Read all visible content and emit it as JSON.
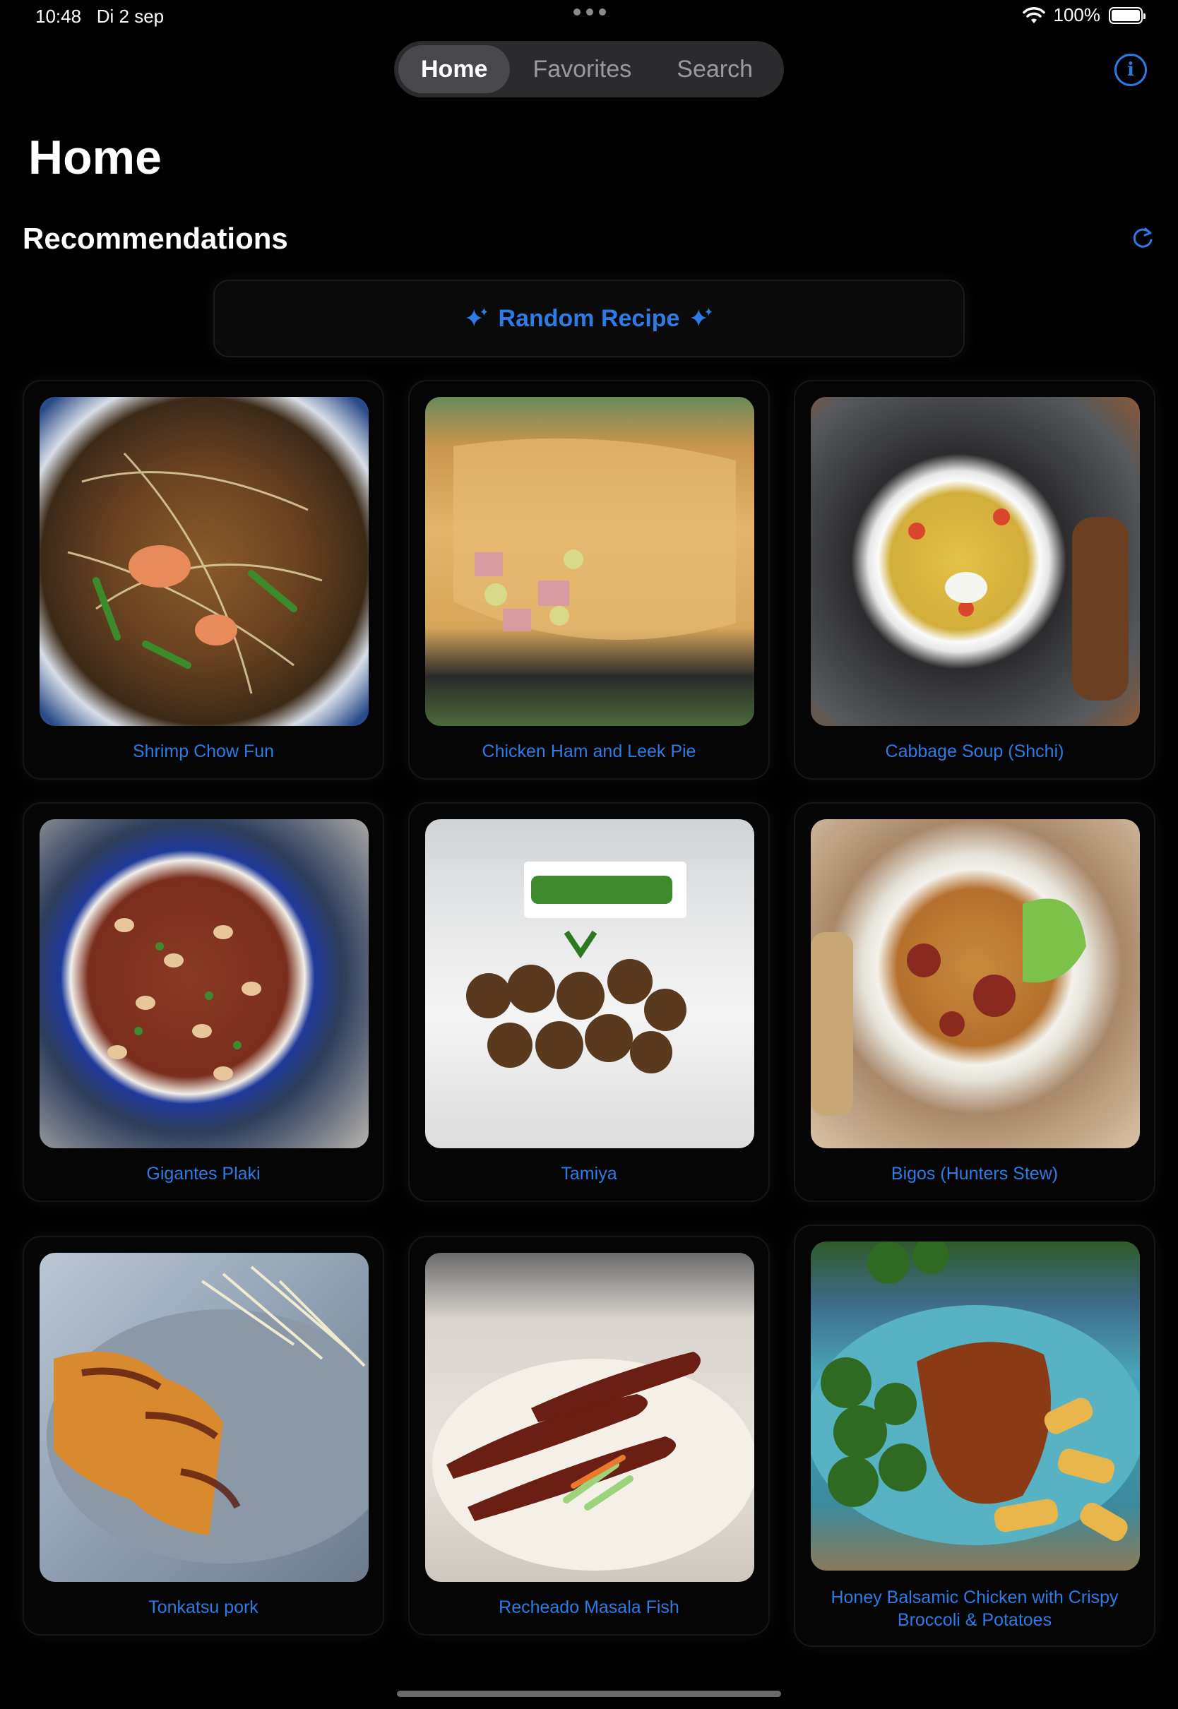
{
  "status_bar": {
    "time": "10:48",
    "date": "Di 2 sep",
    "battery": "100%"
  },
  "tabs": [
    {
      "label": "Home",
      "active": true
    },
    {
      "label": "Favorites",
      "active": false
    },
    {
      "label": "Search",
      "active": false
    }
  ],
  "page_title": "Home",
  "section_title": "Recommendations",
  "random_button": {
    "label": "Random Recipe"
  },
  "colors": {
    "accent": "#2d7be5",
    "background": "#000000",
    "card": "#050505"
  },
  "recipes": [
    {
      "name": "Shrimp Chow Fun"
    },
    {
      "name": "Chicken Ham and Leek Pie"
    },
    {
      "name": "Cabbage Soup (Shchi)"
    },
    {
      "name": "Gigantes Plaki"
    },
    {
      "name": "Tamiya"
    },
    {
      "name": "Bigos (Hunters Stew)"
    },
    {
      "name": "Tonkatsu pork"
    },
    {
      "name": "Recheado Masala Fish"
    },
    {
      "name": "Honey Balsamic Chicken with Crispy Broccoli & Potatoes"
    }
  ]
}
